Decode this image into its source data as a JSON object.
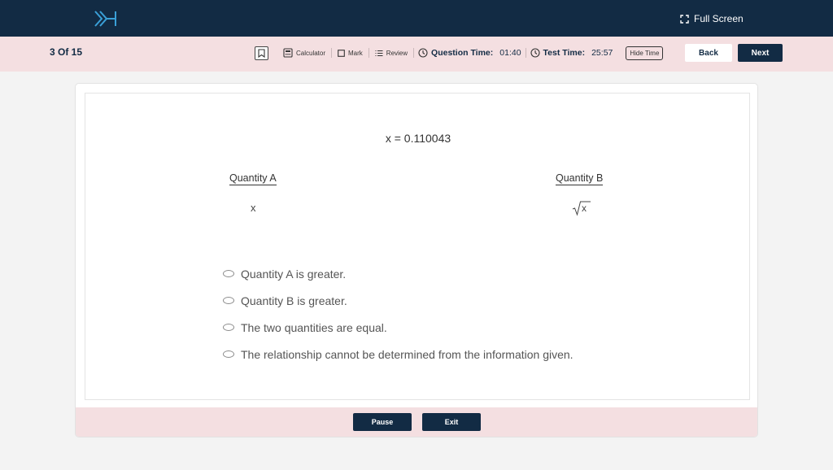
{
  "header": {
    "logo_icon": "chevrons-h-logo",
    "fullscreen_label": "Full Screen",
    "fullscreen_icon": "expand-icon"
  },
  "toolbar": {
    "progress": "3 Of 15",
    "bookmark_icon": "bookmark-icon",
    "calculator_label": "Calculator",
    "mark_label": "Mark",
    "review_label": "Review",
    "question_time_label": "Question Time:",
    "question_time_value": "01:40",
    "test_time_label": "Test Time:",
    "test_time_value": "25:57",
    "hide_time_label": "Hide Time",
    "back_label": "Back",
    "next_label": "Next"
  },
  "question": {
    "given": "x = 0.110043",
    "quantity_a": {
      "label": "Quantity A",
      "value": "x"
    },
    "quantity_b": {
      "label": "Quantity B",
      "value": "x",
      "operator": "square-root"
    },
    "choices": [
      "Quantity A is greater.",
      "Quantity B is greater.",
      "The two quantities are equal.",
      "The relationship cannot be determined from the information given."
    ]
  },
  "footer": {
    "pause_label": "Pause",
    "exit_label": "Exit"
  },
  "colors": {
    "navy": "#122b44",
    "pink": "#f4dfe1",
    "logo_blue": "#3aa0d8"
  }
}
